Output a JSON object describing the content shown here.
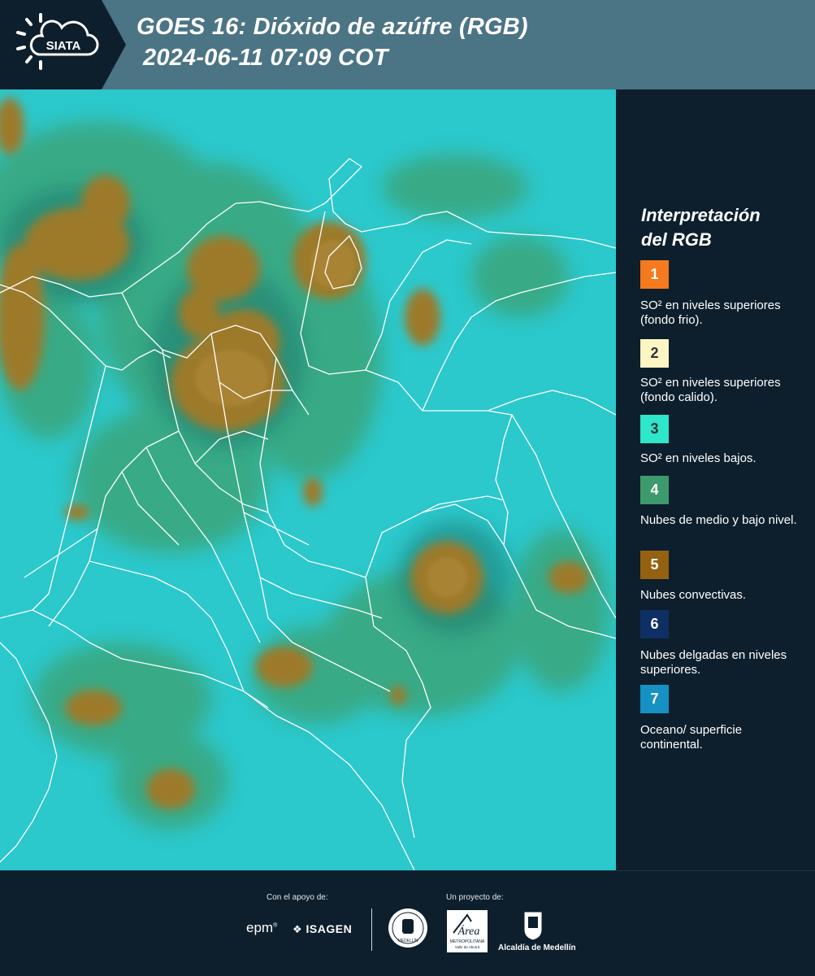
{
  "header": {
    "logo_text": "SIATA",
    "title_line1": "GOES 16: Dióxido de azúfre (RGB)",
    "title_line2": "2024-06-11 07:09 COT"
  },
  "legend": {
    "title_line1": "Interpretación",
    "title_line2": "del RGB",
    "items": [
      {
        "number": "1",
        "color": "#f47a1d",
        "text": "SO² en niveles superiores (fondo frio)."
      },
      {
        "number": "2",
        "color": "#fcf6c3",
        "text": "SO² en niveles superiores (fondo calido)."
      },
      {
        "number": "3",
        "color": "#2ee6c9",
        "text": "SO² en niveles bajos."
      },
      {
        "number": "4",
        "color": "#3d9a6c",
        "text": "Nubes de medio y bajo nivel."
      },
      {
        "number": "5",
        "color": "#946111",
        "text": "Nubes convectivas."
      },
      {
        "number": "6",
        "color": "#0d2f64",
        "text": "Nubes delgadas en niveles superiores."
      },
      {
        "number": "7",
        "color": "#1592c3",
        "text": "Oceano/ superficie continental."
      }
    ]
  },
  "footer": {
    "support_label": "Con el apoyo de:",
    "project_label": "Un proyecto de:",
    "epm": "epm",
    "isagen": "ISAGEN",
    "area_line1": "Área",
    "area_line2": "METROPOLITANA",
    "area_line3": "Valle de Aburrá",
    "alcaldia": "Alcaldía de Medellín",
    "seal_text": "MEDELLÍN"
  },
  "map": {
    "colors": {
      "ocean": "#2bc8cc",
      "low_cloud": "#3aa57a",
      "convective": "#9c7a2c",
      "border": "#ffffff"
    }
  }
}
